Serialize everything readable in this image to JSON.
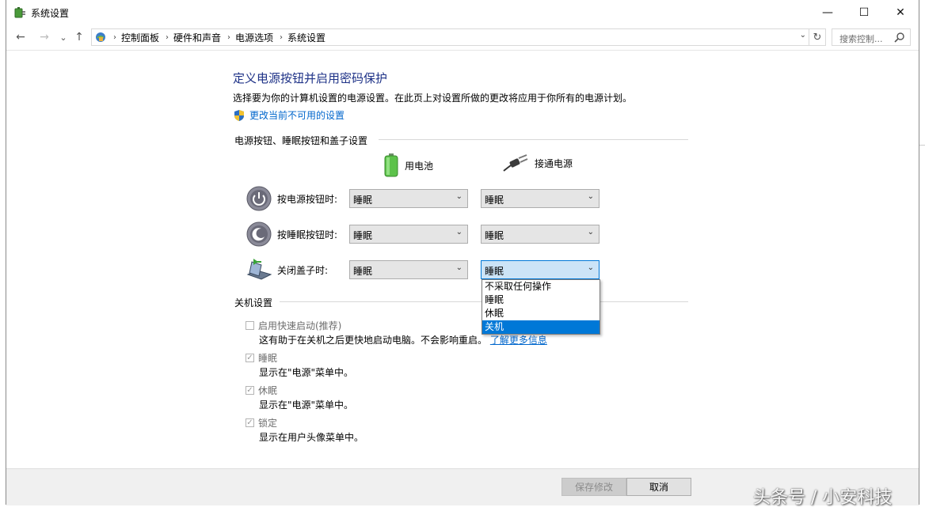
{
  "window": {
    "title": "系统设置",
    "minimize": "—",
    "maximize": "☐",
    "close": "✕"
  },
  "nav": {
    "back": "←",
    "forward": "→",
    "history": "⌄",
    "up": "↑",
    "breadcrumbs": [
      "控制面板",
      "硬件和声音",
      "电源选项",
      "系统设置"
    ],
    "separator": "›",
    "dropdown": "⌄",
    "refresh": "↻",
    "search_placeholder": "搜索控制..."
  },
  "content": {
    "heading": "定义电源按钮并启用密码保护",
    "description": "选择要为你的计算机设置的电源设置。在此页上对设置所做的更改将应用于你所有的电源计划。",
    "change_link": "更改当前不可用的设置",
    "buttons_group": {
      "title": "电源按钮、睡眠按钮和盖子设置",
      "col_battery": "用电池",
      "col_plugged": "接通电源",
      "rows": [
        {
          "label": "按电源按钮时:",
          "battery": "睡眠",
          "plugged": "睡眠"
        },
        {
          "label": "按睡眠按钮时:",
          "battery": "睡眠",
          "plugged": "睡眠"
        },
        {
          "label": "关闭盖子时:",
          "battery": "睡眠",
          "plugged": "睡眠"
        }
      ],
      "dropdown_options": [
        "不采取任何操作",
        "睡眠",
        "休眠",
        "关机"
      ],
      "dropdown_selected_index": 3
    },
    "shutdown_group": {
      "title": "关机设置",
      "items": [
        {
          "label": "启用快速启动(推荐)",
          "checked": false,
          "desc": "这有助于在关机之后更快地启动电脑。不会影响重启。",
          "more": "了解更多信息"
        },
        {
          "label": "睡眠",
          "checked": true,
          "desc": "显示在\"电源\"菜单中。"
        },
        {
          "label": "休眠",
          "checked": true,
          "desc": "显示在\"电源\"菜单中。"
        },
        {
          "label": "锁定",
          "checked": true,
          "desc": "显示在用户头像菜单中。"
        }
      ]
    }
  },
  "footer": {
    "save": "保存修改",
    "cancel": "取消"
  },
  "watermark": "头条号 / 小安科技",
  "colors": {
    "heading": "#1e3287",
    "link": "#0066cc",
    "selection": "#0078d7"
  }
}
